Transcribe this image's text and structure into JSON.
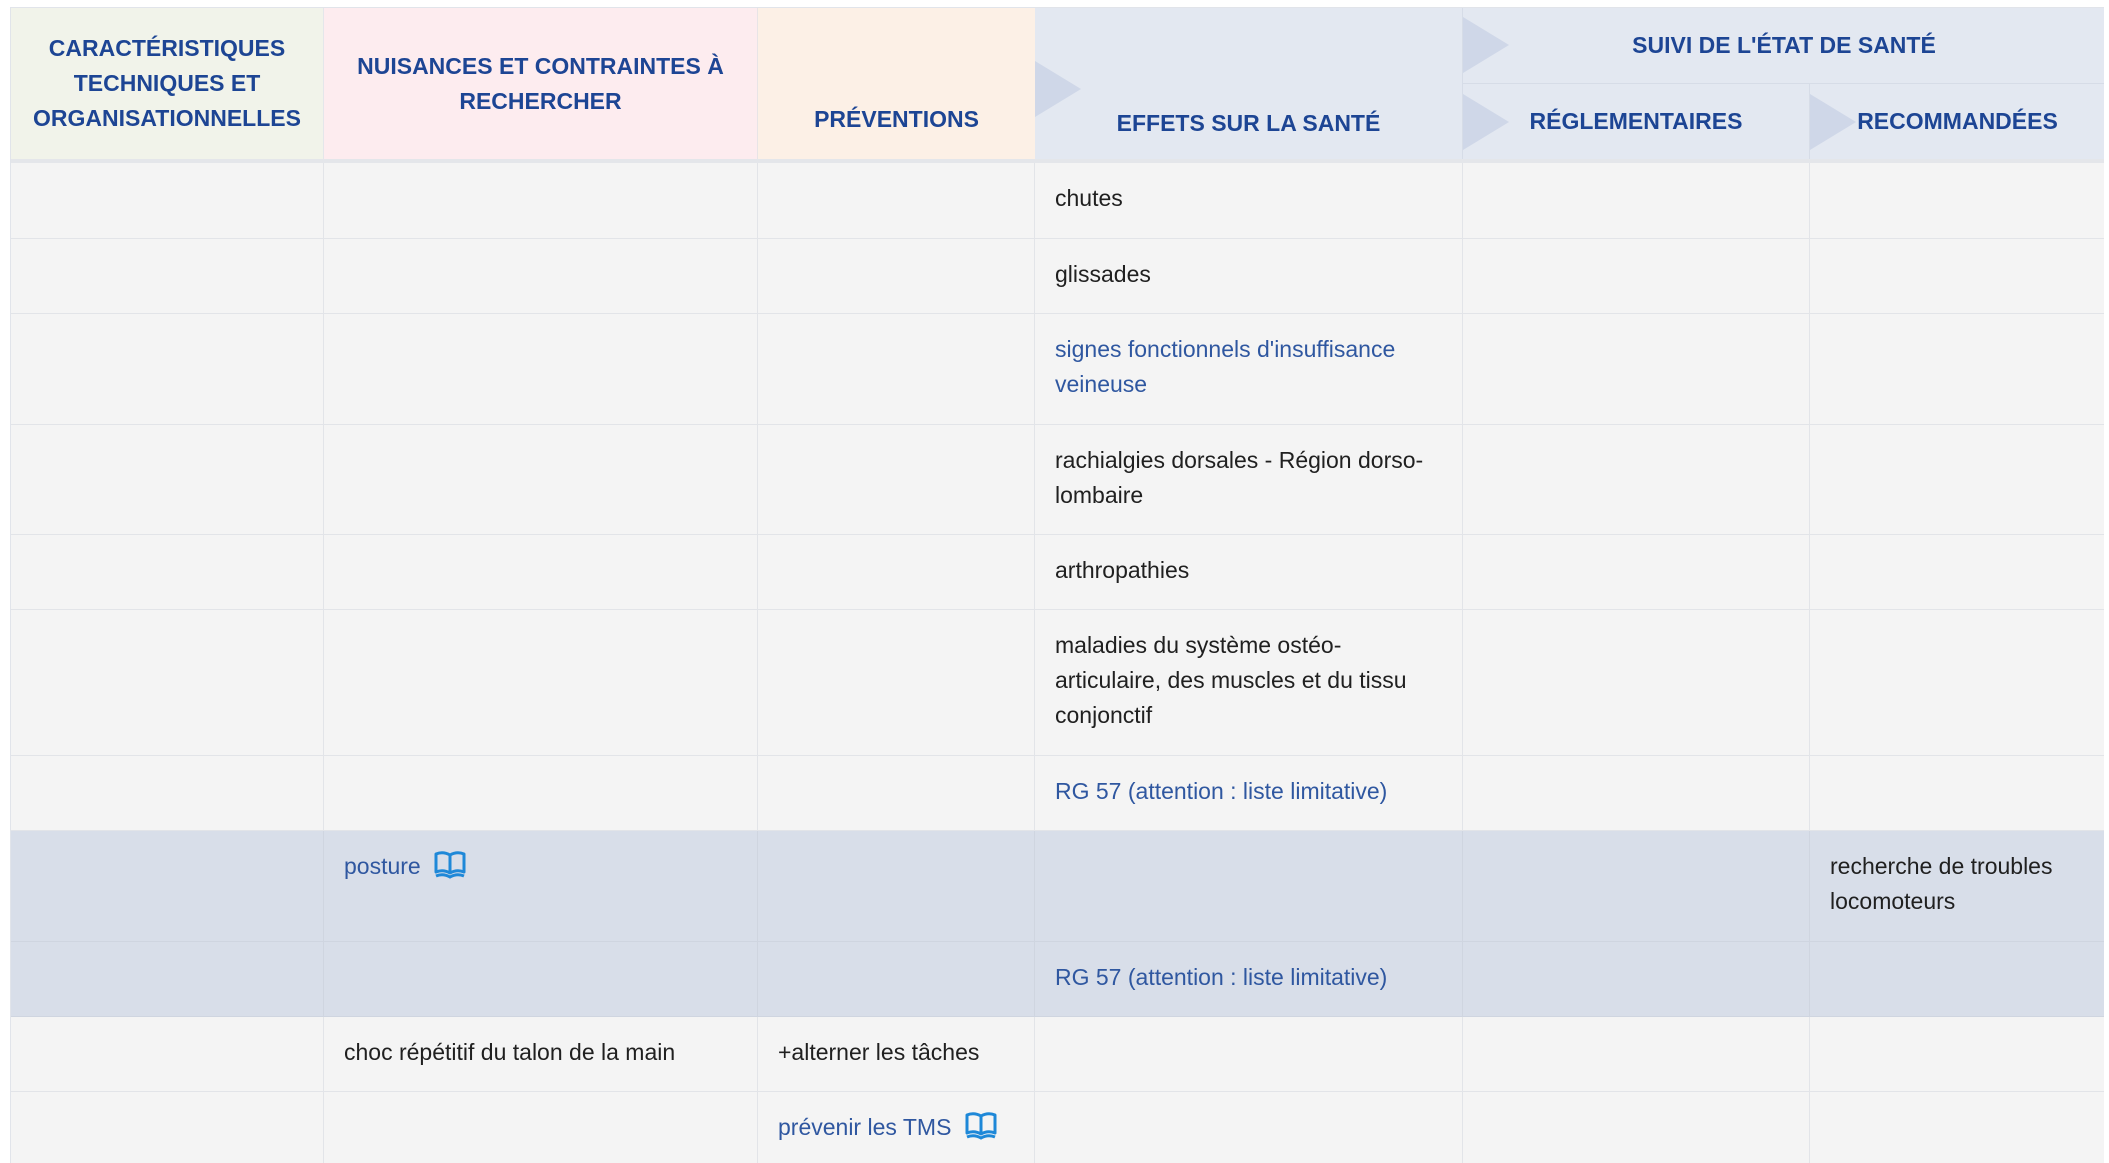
{
  "header": {
    "caracteristiques": "CARACTÉRISTIQUES TECHNIQUES ET ORGANISATIONNELLES",
    "nuisances": "NUISANCES ET CONTRAINTES À RECHERCHER",
    "preventions": "PRÉVENTIONS",
    "effets": "EFFETS SUR LA SANTÉ",
    "suivi": "SUIVI DE L'ÉTAT DE SANTÉ",
    "reglementaires": "RÉGLEMENTAIRES",
    "recommandees": "RECOMMANDÉES"
  },
  "colors": {
    "header_text": "#1d4594",
    "link": "#2f57a0",
    "book_icon": "#1e88d8",
    "row_bg": "#f4f4f4",
    "row_highlight_bg": "#d8dee9"
  },
  "rows": [
    {
      "effets": "chutes"
    },
    {
      "effets": "glissades"
    },
    {
      "effets": "signes fonctionnels d'insuffisance veineuse"
    },
    {
      "effets": "rachialgies dorsales - Région dorso-lombaire"
    },
    {
      "effets": "arthropathies"
    },
    {
      "effets": "maladies du système ostéo-articulaire, des muscles et du tissu conjonctif"
    },
    {
      "effets": "RG 57 (attention : liste limitative)"
    },
    {
      "nuisances": "posture",
      "nuisances_icon": "book-icon",
      "recommandees": "recherche de troubles locomoteurs"
    },
    {
      "effets": "RG 57 (attention : liste limitative)"
    },
    {
      "nuisances": "choc répétitif du talon de la main",
      "preventions": "+alterner les tâches"
    },
    {
      "preventions": "prévenir les TMS",
      "preventions_icon": "book-icon"
    }
  ]
}
